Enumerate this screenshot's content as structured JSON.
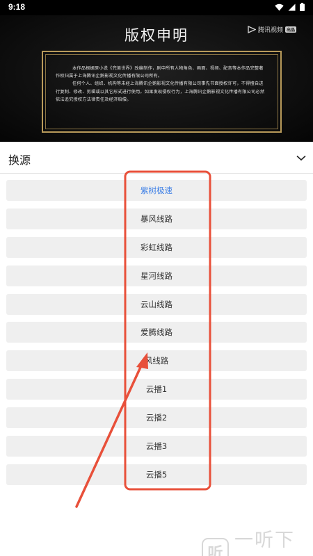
{
  "status_bar": {
    "time": "9:18",
    "icons": [
      "wifi-icon",
      "signal-icon",
      "battery-icon"
    ]
  },
  "video": {
    "title": "版权申明",
    "logo_text": "腾讯视频",
    "logo_badge": "出品",
    "notice": {
      "paragraph_1": "本作品根据原小说《完美世界》改编制作，剧中所有人物角色、画面、视频、配音等本作品完整著作权归属于上海腾讯企鹅影视文化传播有限公司所有。",
      "paragraph_2": "任何个人、组织、机构等未经上海腾讯企鹅影视文化传播有限公司事先书面授权许可，不得擅自进行复制、修改、剪辑或以其它形式进行使用。如果发现侵权行为，上海腾讯企鹅影视文化传播有限公司必然依法追究授权方法律责任及经济赔偿。"
    }
  },
  "sheet": {
    "title": "换源",
    "collapse_icon": "chevron-down-icon"
  },
  "sources": [
    {
      "label": "紫树极速",
      "active": true
    },
    {
      "label": "暴风线路",
      "active": false
    },
    {
      "label": "彩虹线路",
      "active": false
    },
    {
      "label": "星河线路",
      "active": false
    },
    {
      "label": "云山线路",
      "active": false
    },
    {
      "label": "爱腾线路",
      "active": false
    },
    {
      "label": "风线路",
      "active": false
    },
    {
      "label": "云播1",
      "active": false
    },
    {
      "label": "云播2",
      "active": false
    },
    {
      "label": "云播3",
      "active": false
    },
    {
      "label": "云播5",
      "active": false
    }
  ],
  "colors": {
    "active_text": "#3d7fe6",
    "annotation": "#e8503a",
    "notice_border": "#b89a5a"
  },
  "watermark": {
    "badge": "听",
    "text": "一听下载"
  }
}
